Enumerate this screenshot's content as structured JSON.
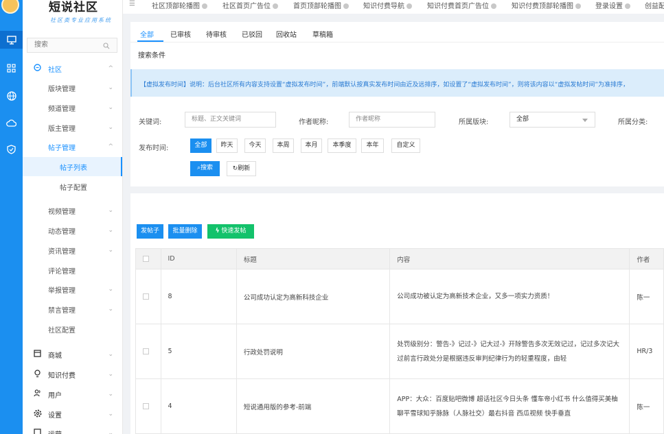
{
  "app": {
    "logo_title": "短说社区",
    "logo_subtitle": "社区类专业应用系统"
  },
  "sidebar": {
    "search_placeholder": "搜索",
    "community": "社区",
    "items": [
      {
        "label": "版块管理"
      },
      {
        "label": "频道管理"
      },
      {
        "label": "版主管理"
      },
      {
        "label": "帖子管理"
      },
      {
        "label": "帖子列表"
      },
      {
        "label": "帖子配置"
      },
      {
        "label": "视频管理"
      },
      {
        "label": "动态管理"
      },
      {
        "label": "资讯管理"
      },
      {
        "label": "评论管理"
      },
      {
        "label": "举报管理"
      },
      {
        "label": "禁言管理"
      },
      {
        "label": "社区配置"
      }
    ],
    "groups": [
      {
        "label": "商城"
      },
      {
        "label": "知识付费"
      },
      {
        "label": "用户"
      },
      {
        "label": "设置"
      },
      {
        "label": "运营"
      }
    ]
  },
  "top_tabs": [
    {
      "label": "社区顶部轮播图"
    },
    {
      "label": "社区首页广告位"
    },
    {
      "label": "首页顶部轮播图"
    },
    {
      "label": "知识付费导航"
    },
    {
      "label": "知识付费首页广告位"
    },
    {
      "label": "知识付费顶部轮播图"
    },
    {
      "label": "登录设置"
    },
    {
      "label": "创益配"
    }
  ],
  "content_tabs": [
    {
      "label": "全部"
    },
    {
      "label": "已审核"
    },
    {
      "label": "待审核"
    },
    {
      "label": "已驳回"
    },
    {
      "label": "回收站"
    },
    {
      "label": "草稿箱"
    }
  ],
  "criteria_title": "搜索条件",
  "notice": "【虚拟发布时间】说明：后台社区所有内容支持设置“虚拟发布时间”，前端默认按真实发布时间由近及远排序，如设置了“虚拟发布时间”，则将该内容以“虚拟发帖时间”为准排序，",
  "filters": {
    "keyword_label": "关键词:",
    "keyword_placeholder": "标题、正文关键词",
    "author_label": "作者昵称:",
    "author_placeholder": "作者昵称",
    "section_label": "所属版块:",
    "section_value": "全部",
    "category_label": "所属分类:",
    "time_label": "发布时间:",
    "time_options": [
      {
        "label": "全部"
      },
      {
        "label": "昨天"
      },
      {
        "label": "今天"
      },
      {
        "label": "本周"
      },
      {
        "label": "本月"
      },
      {
        "label": "本季度"
      },
      {
        "label": "本年"
      },
      {
        "label": "自定义"
      }
    ],
    "search_button": "搜索",
    "refresh_button": "刷新"
  },
  "actions": {
    "post": "发帖子",
    "batch_delete": "批量删除",
    "quick_post": "快速发帖"
  },
  "table": {
    "headers": {
      "id": "ID",
      "title": "标题",
      "content": "内容",
      "author": "作者"
    },
    "rows": [
      {
        "id": "8",
        "title": "公司成功认定为高新科技企业",
        "content": "公司成功被认定为高新技术企业，又多一项实力资质！",
        "author": "陈一"
      },
      {
        "id": "5",
        "title": "行政处罚说明",
        "content": "处罚级别分：警告-》记过-》记大过-》开除警告多次无效记过，记过多次记大过前言行政处分是根据违反审判纪律行为的轻重程度，由轻",
        "author": "HR/3"
      },
      {
        "id": "4",
        "title": "短说通用版的参考-前端",
        "content": "APP：大众：百度贴吧微博 超话社区今日头条 懂车帝小红书 什么值得买美柚聊平雪球知乎脉脉（人脉社交）最右抖音 西瓜视频 快手垂直",
        "author": "陈一"
      }
    ]
  },
  "colors": {
    "primary": "#1890ff",
    "rail": "#1b8ff0",
    "quick_post": "#13c26b"
  }
}
